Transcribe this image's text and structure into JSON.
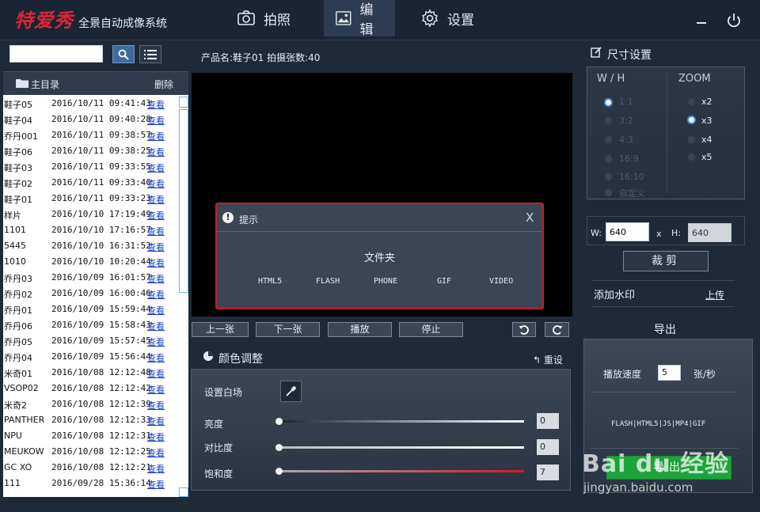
{
  "app": {
    "brand": "特爱秀",
    "subtitle": "全景自动成像系统"
  },
  "nav": {
    "tabs": [
      {
        "label": "拍照",
        "icon": "camera-icon",
        "active": false
      },
      {
        "label": "编辑",
        "icon": "image-icon",
        "active": true
      },
      {
        "label": "设置",
        "icon": "gear-icon",
        "active": false
      }
    ]
  },
  "left": {
    "search": {
      "value": "",
      "placeholder": ""
    },
    "directory_title": "主目录",
    "delete_label": "删除",
    "view_label": "查看",
    "files": [
      {
        "name": "鞋子05",
        "time": "2016/10/11 09:41:43"
      },
      {
        "name": "鞋子04",
        "time": "2016/10/11 09:40:28"
      },
      {
        "name": "乔丹001",
        "time": "2016/10/11 09:38:57"
      },
      {
        "name": "鞋子06",
        "time": "2016/10/11 09:38:25"
      },
      {
        "name": "鞋子03",
        "time": "2016/10/11 09:33:55"
      },
      {
        "name": "鞋子02",
        "time": "2016/10/11 09:33:40"
      },
      {
        "name": "鞋子01",
        "time": "2016/10/11 09:33:23"
      },
      {
        "name": "样片",
        "time": "2016/10/10 17:19:49"
      },
      {
        "name": "1101",
        "time": "2016/10/10 17:16:57"
      },
      {
        "name": "5445",
        "time": "2016/10/10 16:31:52"
      },
      {
        "name": "1010",
        "time": "2016/10/10 10:20:44"
      },
      {
        "name": "乔丹03",
        "time": "2016/10/09 16:01:57"
      },
      {
        "name": "乔丹02",
        "time": "2016/10/09 16:00:46"
      },
      {
        "name": "乔丹01",
        "time": "2016/10/09 15:59:44"
      },
      {
        "name": "乔丹06",
        "time": "2016/10/09 15:58:43"
      },
      {
        "name": "乔丹05",
        "time": "2016/10/09 15:57:45"
      },
      {
        "name": "乔丹04",
        "time": "2016/10/09 15:56:44"
      },
      {
        "name": "米奇01",
        "time": "2016/10/08 12:12:48"
      },
      {
        "name": "VSOP02",
        "time": "2016/10/08 12:12:42"
      },
      {
        "name": "米奇2",
        "time": "2016/10/08 12:12:39"
      },
      {
        "name": "PANTHER",
        "time": "2016/10/08 12:12:33"
      },
      {
        "name": "NPU",
        "time": "2016/10/08 12:12:31"
      },
      {
        "name": "MEUKOW",
        "time": "2016/10/08 12:12:25"
      },
      {
        "name": "GC XO",
        "time": "2016/10/08 12:12:21"
      },
      {
        "name": "111",
        "time": "2016/09/28 15:36:14"
      }
    ]
  },
  "center": {
    "product_info": "产品名:鞋子01  拍摄张数:40",
    "dialog": {
      "title": "提示",
      "close": "X",
      "message": "文件夹",
      "options": [
        "HTML5",
        "FLASH",
        "PHONE",
        "GIF",
        "VIDEO"
      ]
    },
    "controls": {
      "prev": "上一张",
      "next": "下一张",
      "play": "播放",
      "stop": "停止"
    },
    "color": {
      "title": "颜色调整",
      "reset": "重设",
      "white_balance": "设置白场",
      "sliders": [
        {
          "label": "亮度",
          "value": "0"
        },
        {
          "label": "对比度",
          "value": "0"
        },
        {
          "label": "饱和度",
          "value": "7"
        }
      ]
    }
  },
  "right": {
    "size_title": "尺寸设置",
    "wh_header": "W / H",
    "zoom_header": "ZOOM",
    "ratios": [
      {
        "label": "1:1",
        "selected": true
      },
      {
        "label": "3:2",
        "selected": false
      },
      {
        "label": "4:3",
        "selected": false
      },
      {
        "label": "16:9",
        "selected": false
      },
      {
        "label": "16:10",
        "selected": false
      },
      {
        "label": "自定义",
        "selected": false
      }
    ],
    "zooms": [
      {
        "label": "x2",
        "selected": false
      },
      {
        "label": "x3",
        "selected": true
      },
      {
        "label": "x4",
        "selected": false
      },
      {
        "label": "x5",
        "selected": false
      }
    ],
    "w_label": "W:",
    "w_value": "640",
    "x_label": "x",
    "h_label": "H:",
    "h_value": "640",
    "crop": "裁剪",
    "watermark": "添加水印",
    "upload": "上传",
    "export_title": "导出",
    "speed_label": "播放速度",
    "speed_value": "5",
    "speed_unit": "张/秒",
    "formats": "FLASH|HTML5|JS|MP4|GIF",
    "export_button": "导出"
  },
  "watermark": {
    "logo": "Bai du 经验",
    "url": "jingyan.baidu.com"
  },
  "colors": {
    "accent_blue": "#3c6b9c",
    "alert_red": "#c81f27",
    "export_green": "#1ea33a",
    "brand_red": "#d8263a"
  }
}
